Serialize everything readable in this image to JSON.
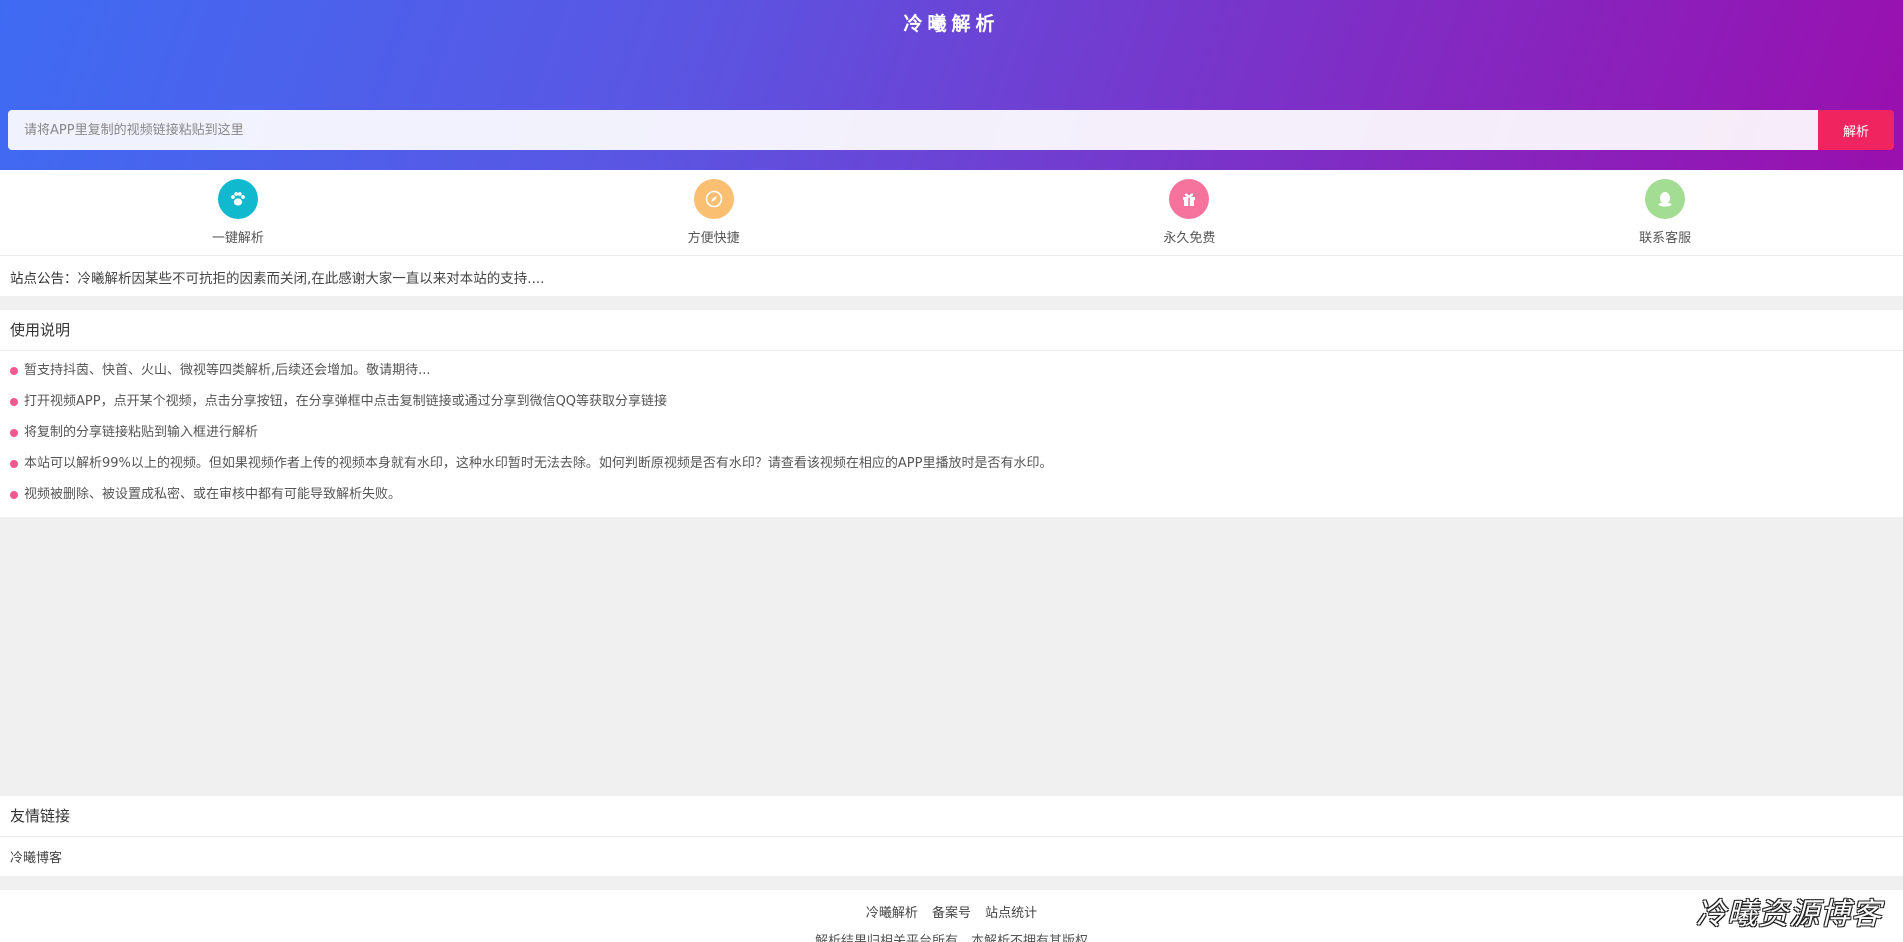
{
  "header": {
    "title": "冷曦解析",
    "search_placeholder": "请将APP里复制的视频链接粘贴到这里",
    "search_value": "",
    "parse_label": "解析"
  },
  "features": [
    {
      "label": "一键解析",
      "icon": "paw-icon",
      "color": "#10b9ce"
    },
    {
      "label": "方便快捷",
      "icon": "compass-icon",
      "color": "#fbbf72"
    },
    {
      "label": "永久免费",
      "icon": "gift-icon",
      "color": "#f6739e"
    },
    {
      "label": "联系客服",
      "icon": "qq-icon",
      "color": "#a3dd93"
    }
  ],
  "notice": {
    "label": "站点公告：",
    "text": "冷曦解析因某些不可抗拒的因素而关闭,在此感谢大家一直以来对本站的支持...."
  },
  "instructions": {
    "title": "使用说明",
    "items": [
      "暂支持抖茵、快首、火山、微视等四类解析,后续还会增加。敬请期待...",
      "打开视频APP，点开某个视频，点击分享按钮，在分享弹框中点击复制链接或通过分享到微信QQ等获取分享链接",
      "将复制的分享链接粘贴到输入框进行解析",
      "本站可以解析99%以上的视频。但如果视频作者上传的视频本身就有水印，这种水印暂时无法去除。如何判断原视频是否有水印？请查看该视频在相应的APP里播放时是否有水印。",
      "视频被删除、被设置成私密、或在审核中都有可能导致解析失败。"
    ],
    "bullet_color": "#f15a8e"
  },
  "links": {
    "title": "友情链接",
    "items": [
      "冷曦博客"
    ]
  },
  "footer": {
    "links": [
      "冷曦解析",
      "备案号",
      "站点统计"
    ],
    "note": "解析结果归相关平台所有，本解析不拥有其版权"
  },
  "watermark": "冷曦资源博客"
}
